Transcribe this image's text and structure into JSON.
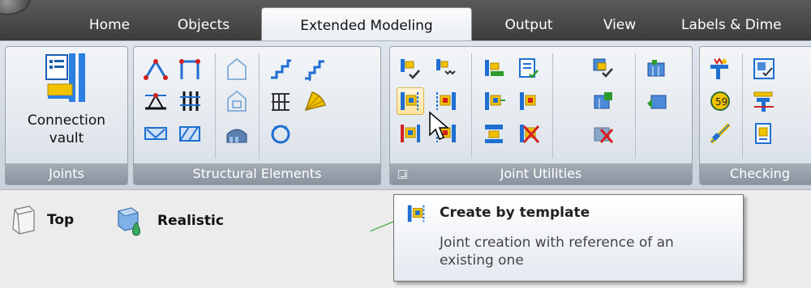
{
  "tabs": [
    {
      "label": "Home",
      "active": false
    },
    {
      "label": "Objects",
      "active": false
    },
    {
      "label": "Extended Modeling",
      "active": true
    },
    {
      "label": "Output",
      "active": false
    },
    {
      "label": "View",
      "active": false
    },
    {
      "label": "Labels & Dime",
      "active": false
    }
  ],
  "groups": {
    "joints": {
      "label": "Joints",
      "connection_vault_label": "Connection\nvault"
    },
    "structural": {
      "label": "Structural Elements"
    },
    "joint_utilities": {
      "label": "Joint Utilities"
    },
    "checking": {
      "label": "Checking"
    }
  },
  "view": {
    "direction_label": "Top",
    "style_label": "Realistic"
  },
  "tooltip": {
    "title": "Create by template",
    "description": "Joint creation with reference of an existing one"
  },
  "colors": {
    "tab_bar": "#4a4a4a",
    "group_label_bg": "#959da8",
    "hover": "#ffe29a",
    "icon_blue": "#1f6fd1",
    "icon_yellow": "#f2c200",
    "icon_red": "#d22020"
  }
}
